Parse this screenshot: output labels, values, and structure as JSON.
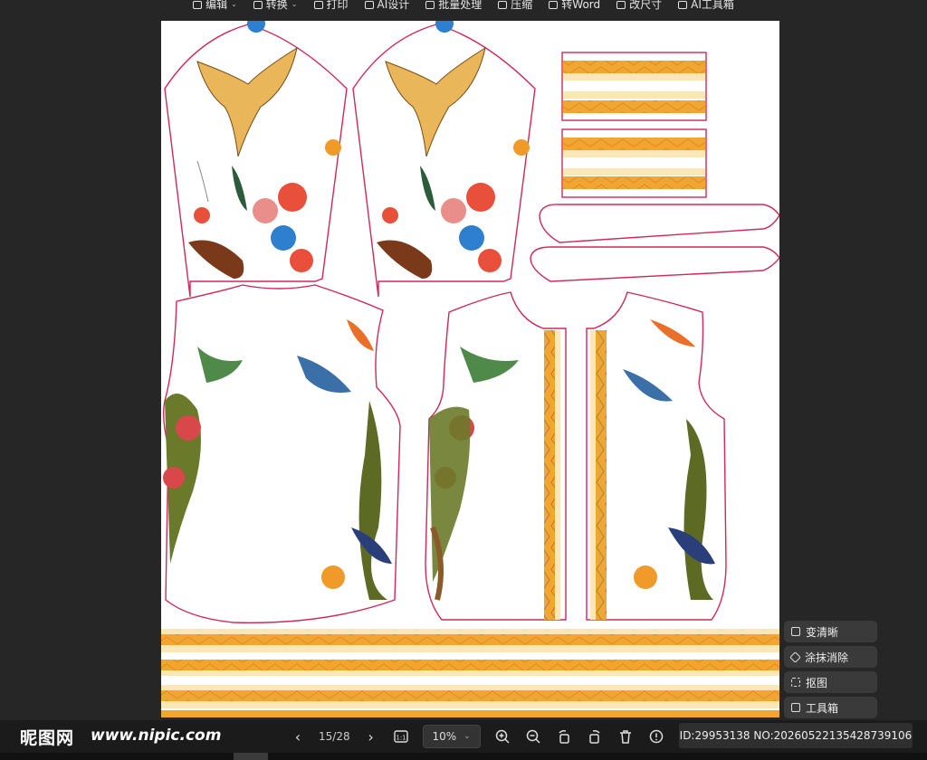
{
  "toolbar": {
    "items": [
      {
        "label": "编辑",
        "caret": true,
        "icon": "edit-icon"
      },
      {
        "label": "转换",
        "caret": true,
        "icon": "convert-icon"
      },
      {
        "label": "打印",
        "caret": false,
        "icon": "print-icon"
      },
      {
        "label": "AI设计",
        "caret": false,
        "icon": "ai-design-icon"
      },
      {
        "label": "批量处理",
        "caret": false,
        "icon": "batch-icon"
      },
      {
        "label": "压缩",
        "caret": false,
        "icon": "compress-icon"
      },
      {
        "label": "转Word",
        "caret": false,
        "icon": "word-icon"
      },
      {
        "label": "改尺寸",
        "caret": false,
        "icon": "resize-icon"
      },
      {
        "label": "AI工具箱",
        "caret": false,
        "icon": "ai-toolbox-icon"
      }
    ]
  },
  "side_tools": {
    "enhance": "变清晰",
    "erase": "涂抹消除",
    "cutout": "抠图",
    "toolbox": "工具箱"
  },
  "footer": {
    "logo": "昵图网",
    "site": "www.nipic.com",
    "page": "15/28",
    "zoom": "10%",
    "id_text": "ID:29953138 NO:20260522135428739106"
  },
  "colors": {
    "background": "#262626",
    "stripe_orange": "#f0a632",
    "stripe_cream": "#fbe7b5",
    "outline": "#d0285a"
  }
}
